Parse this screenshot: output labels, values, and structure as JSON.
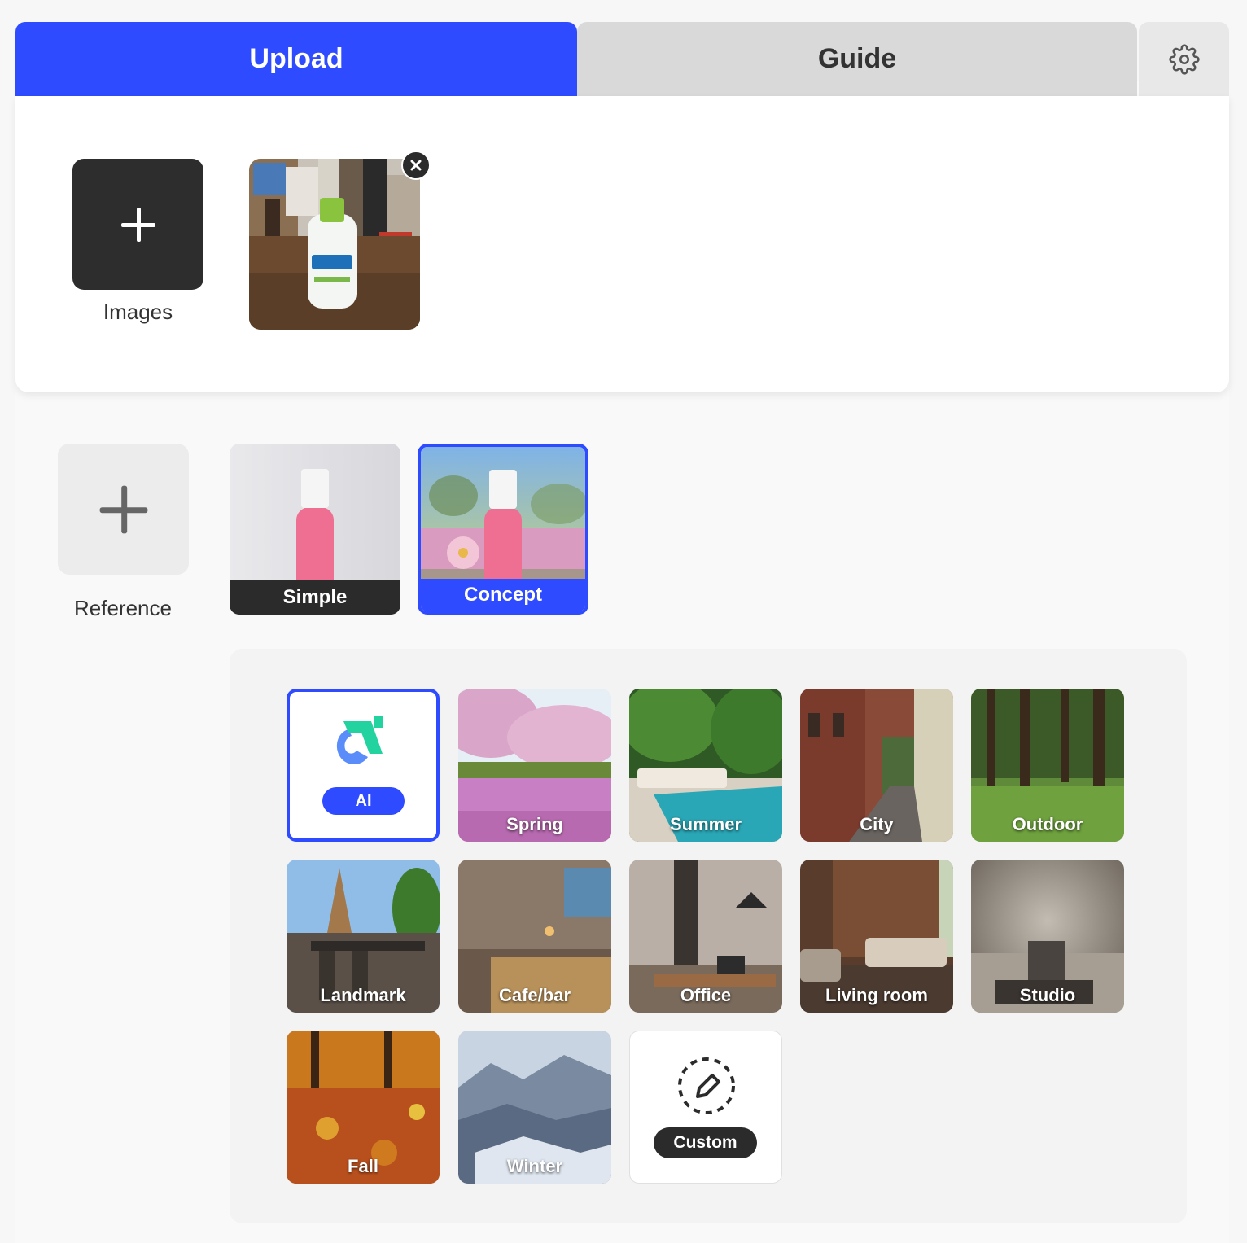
{
  "tabs": {
    "upload": "Upload",
    "guide": "Guide",
    "settings_icon": "gear-icon"
  },
  "upload": {
    "images_label": "Images",
    "uploaded_thumbnail": "cetaphil-bottle-photo"
  },
  "reference": {
    "label": "Reference",
    "modes": [
      {
        "label": "Simple",
        "selected": false
      },
      {
        "label": "Concept",
        "selected": true
      }
    ]
  },
  "scenes": {
    "items": [
      {
        "label": "AI",
        "selected": true
      },
      {
        "label": "Spring"
      },
      {
        "label": "Summer"
      },
      {
        "label": "City"
      },
      {
        "label": "Outdoor"
      },
      {
        "label": "Landmark"
      },
      {
        "label": "Cafe/bar"
      },
      {
        "label": "Office"
      },
      {
        "label": "Living room"
      },
      {
        "label": "Studio"
      },
      {
        "label": "Fall"
      },
      {
        "label": "Winter"
      },
      {
        "label": "Custom"
      }
    ]
  },
  "colors": {
    "accent": "#2f4bff",
    "dark": "#2b2b2b"
  }
}
